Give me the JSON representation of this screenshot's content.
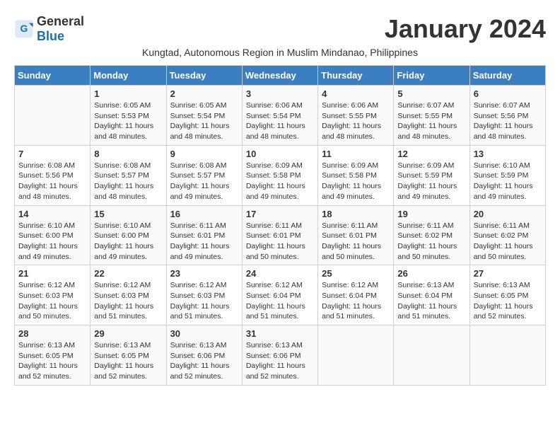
{
  "header": {
    "logo_general": "General",
    "logo_blue": "Blue",
    "month_title": "January 2024",
    "subtitle": "Kungtad, Autonomous Region in Muslim Mindanao, Philippines"
  },
  "days_of_week": [
    "Sunday",
    "Monday",
    "Tuesday",
    "Wednesday",
    "Thursday",
    "Friday",
    "Saturday"
  ],
  "weeks": [
    [
      {
        "day": "",
        "info": ""
      },
      {
        "day": "1",
        "info": "Sunrise: 6:05 AM\nSunset: 5:53 PM\nDaylight: 11 hours\nand 48 minutes."
      },
      {
        "day": "2",
        "info": "Sunrise: 6:05 AM\nSunset: 5:54 PM\nDaylight: 11 hours\nand 48 minutes."
      },
      {
        "day": "3",
        "info": "Sunrise: 6:06 AM\nSunset: 5:54 PM\nDaylight: 11 hours\nand 48 minutes."
      },
      {
        "day": "4",
        "info": "Sunrise: 6:06 AM\nSunset: 5:55 PM\nDaylight: 11 hours\nand 48 minutes."
      },
      {
        "day": "5",
        "info": "Sunrise: 6:07 AM\nSunset: 5:55 PM\nDaylight: 11 hours\nand 48 minutes."
      },
      {
        "day": "6",
        "info": "Sunrise: 6:07 AM\nSunset: 5:56 PM\nDaylight: 11 hours\nand 48 minutes."
      }
    ],
    [
      {
        "day": "7",
        "info": "Sunrise: 6:08 AM\nSunset: 5:56 PM\nDaylight: 11 hours\nand 48 minutes."
      },
      {
        "day": "8",
        "info": "Sunrise: 6:08 AM\nSunset: 5:57 PM\nDaylight: 11 hours\nand 48 minutes."
      },
      {
        "day": "9",
        "info": "Sunrise: 6:08 AM\nSunset: 5:57 PM\nDaylight: 11 hours\nand 49 minutes."
      },
      {
        "day": "10",
        "info": "Sunrise: 6:09 AM\nSunset: 5:58 PM\nDaylight: 11 hours\nand 49 minutes."
      },
      {
        "day": "11",
        "info": "Sunrise: 6:09 AM\nSunset: 5:58 PM\nDaylight: 11 hours\nand 49 minutes."
      },
      {
        "day": "12",
        "info": "Sunrise: 6:09 AM\nSunset: 5:59 PM\nDaylight: 11 hours\nand 49 minutes."
      },
      {
        "day": "13",
        "info": "Sunrise: 6:10 AM\nSunset: 5:59 PM\nDaylight: 11 hours\nand 49 minutes."
      }
    ],
    [
      {
        "day": "14",
        "info": "Sunrise: 6:10 AM\nSunset: 6:00 PM\nDaylight: 11 hours\nand 49 minutes."
      },
      {
        "day": "15",
        "info": "Sunrise: 6:10 AM\nSunset: 6:00 PM\nDaylight: 11 hours\nand 49 minutes."
      },
      {
        "day": "16",
        "info": "Sunrise: 6:11 AM\nSunset: 6:01 PM\nDaylight: 11 hours\nand 49 minutes."
      },
      {
        "day": "17",
        "info": "Sunrise: 6:11 AM\nSunset: 6:01 PM\nDaylight: 11 hours\nand 50 minutes."
      },
      {
        "day": "18",
        "info": "Sunrise: 6:11 AM\nSunset: 6:01 PM\nDaylight: 11 hours\nand 50 minutes."
      },
      {
        "day": "19",
        "info": "Sunrise: 6:11 AM\nSunset: 6:02 PM\nDaylight: 11 hours\nand 50 minutes."
      },
      {
        "day": "20",
        "info": "Sunrise: 6:11 AM\nSunset: 6:02 PM\nDaylight: 11 hours\nand 50 minutes."
      }
    ],
    [
      {
        "day": "21",
        "info": "Sunrise: 6:12 AM\nSunset: 6:03 PM\nDaylight: 11 hours\nand 50 minutes."
      },
      {
        "day": "22",
        "info": "Sunrise: 6:12 AM\nSunset: 6:03 PM\nDaylight: 11 hours\nand 51 minutes."
      },
      {
        "day": "23",
        "info": "Sunrise: 6:12 AM\nSunset: 6:03 PM\nDaylight: 11 hours\nand 51 minutes."
      },
      {
        "day": "24",
        "info": "Sunrise: 6:12 AM\nSunset: 6:04 PM\nDaylight: 11 hours\nand 51 minutes."
      },
      {
        "day": "25",
        "info": "Sunrise: 6:12 AM\nSunset: 6:04 PM\nDaylight: 11 hours\nand 51 minutes."
      },
      {
        "day": "26",
        "info": "Sunrise: 6:13 AM\nSunset: 6:04 PM\nDaylight: 11 hours\nand 51 minutes."
      },
      {
        "day": "27",
        "info": "Sunrise: 6:13 AM\nSunset: 6:05 PM\nDaylight: 11 hours\nand 52 minutes."
      }
    ],
    [
      {
        "day": "28",
        "info": "Sunrise: 6:13 AM\nSunset: 6:05 PM\nDaylight: 11 hours\nand 52 minutes."
      },
      {
        "day": "29",
        "info": "Sunrise: 6:13 AM\nSunset: 6:05 PM\nDaylight: 11 hours\nand 52 minutes."
      },
      {
        "day": "30",
        "info": "Sunrise: 6:13 AM\nSunset: 6:06 PM\nDaylight: 11 hours\nand 52 minutes."
      },
      {
        "day": "31",
        "info": "Sunrise: 6:13 AM\nSunset: 6:06 PM\nDaylight: 11 hours\nand 52 minutes."
      },
      {
        "day": "",
        "info": ""
      },
      {
        "day": "",
        "info": ""
      },
      {
        "day": "",
        "info": ""
      }
    ]
  ]
}
